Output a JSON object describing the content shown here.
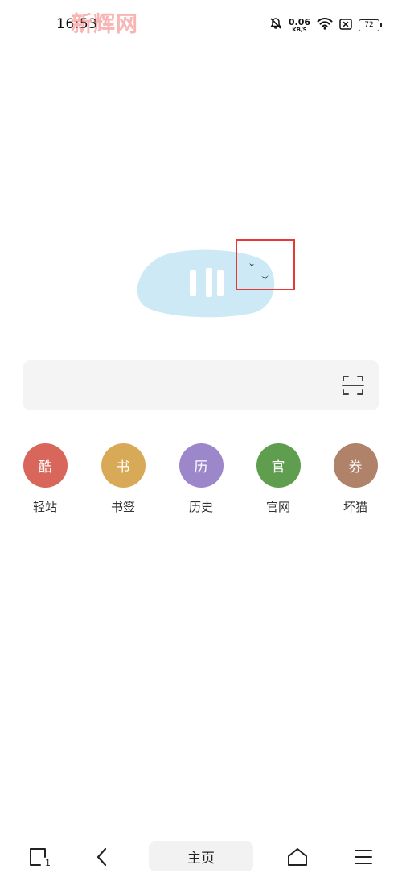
{
  "status_bar": {
    "time": "16:53",
    "watermark": "新辉网",
    "net_speed": "0.06",
    "net_unit": "KB/S",
    "battery": "72",
    "icons": [
      "bell-muted-icon",
      "wifi-icon",
      "sim-x-icon",
      "battery-icon"
    ]
  },
  "search": {
    "placeholder": "",
    "value": "",
    "scan_icon": "scan-icon"
  },
  "quick_links": [
    {
      "glyph": "酷",
      "label": "轻站",
      "color": "#d9665a"
    },
    {
      "glyph": "书",
      "label": "书签",
      "color": "#d8aa57"
    },
    {
      "glyph": "历",
      "label": "历史",
      "color": "#9d87cb"
    },
    {
      "glyph": "官",
      "label": "官网",
      "color": "#5f9e4f"
    },
    {
      "glyph": "券",
      "label": "坏猫",
      "color": "#b0826a"
    }
  ],
  "bottom_nav": {
    "tab_count": "1",
    "home_label": "主页",
    "icons": [
      "tabs-icon",
      "back-icon",
      "home-icon",
      "menu-icon"
    ]
  },
  "colors": {
    "illustration_blue": "#cde9f5",
    "highlight_red": "#e53935",
    "search_bg": "#f4f4f4"
  }
}
